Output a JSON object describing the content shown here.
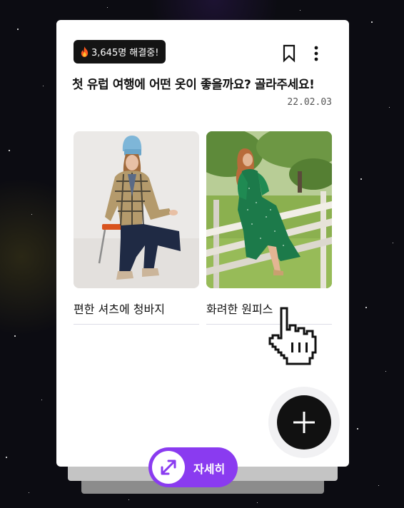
{
  "badge": {
    "icon": "fire-icon",
    "text": "3,645명 해결중!"
  },
  "header": {
    "bookmark_icon": "bookmark-icon",
    "menu_icon": "more-vertical-icon"
  },
  "question": {
    "title": "첫 유럽 여행에 어떤 옷이 좋을까요? 골라주세요!",
    "date": "22.02.03"
  },
  "options": [
    {
      "label": "편한 셔츠에 청바지",
      "image": "woman-plaid-shirt-jeans-photo"
    },
    {
      "label": "화려한 원피스",
      "image": "woman-green-dress-fence-photo"
    }
  ],
  "fab": {
    "icon": "plus-icon"
  },
  "details_button": {
    "label": "자세히",
    "icon": "expand-arrows-icon"
  },
  "cursor": {
    "icon": "hand-pointer-icon"
  },
  "colors": {
    "accent": "#8a3bf0",
    "badge_bg": "#141414",
    "fab_bg": "#111111",
    "background": "#0c0c12"
  }
}
